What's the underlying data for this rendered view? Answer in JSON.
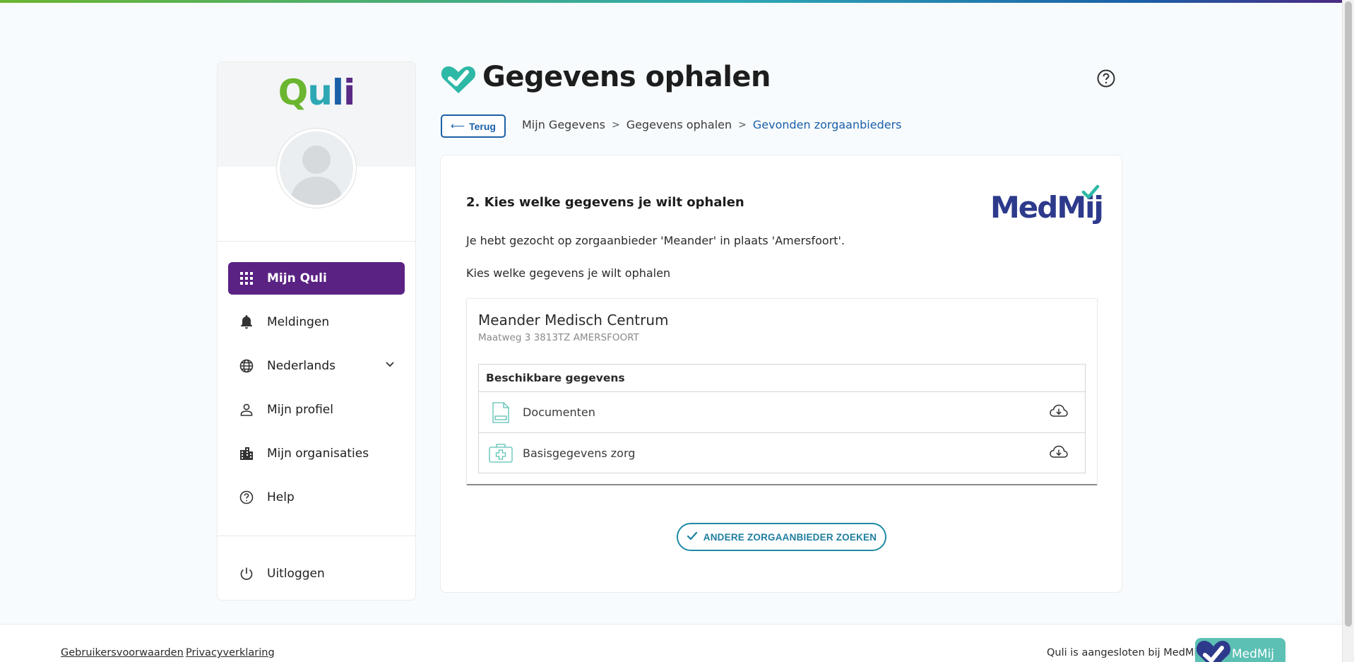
{
  "app": {
    "logo_text": "Quli"
  },
  "sidebar": {
    "items": [
      {
        "label": "Mijn Quli",
        "icon": "grid-icon",
        "active": true
      },
      {
        "label": "Meldingen",
        "icon": "bell-icon"
      },
      {
        "label": "Nederlands",
        "icon": "globe-icon"
      },
      {
        "label": "Mijn profiel",
        "icon": "person-icon"
      },
      {
        "label": "Mijn organisaties",
        "icon": "buildings-icon"
      },
      {
        "label": "Help",
        "icon": "help-circle-icon"
      }
    ],
    "logout_label": "Uitloggen"
  },
  "header": {
    "title": "Gegevens ophalen",
    "back_label": "Terug",
    "breadcrumb": [
      "Mijn Gegevens",
      "Gegevens ophalen",
      "Gevonden zorgaanbieders"
    ]
  },
  "card": {
    "step_title": "2. Kies welke gegevens je wilt ophalen",
    "medmij_logo_text": "MedMij",
    "search_info": "Je hebt gezocht op zorgaanbieder 'Meander' in plaats 'Amersfoort'.",
    "instruction": "Kies welke gegevens je wilt ophalen",
    "provider": {
      "name": "Meander Medisch Centrum",
      "address": "Maatweg 3 3813TZ AMERSFOORT",
      "available_header": "Beschikbare gegevens",
      "items": [
        {
          "label": "Documenten",
          "icon": "document-icon"
        },
        {
          "label": "Basisgegevens zorg",
          "icon": "medical-kit-icon"
        }
      ]
    },
    "other_button": "ANDERE ZORGAANBIEDER ZOEKEN"
  },
  "footer": {
    "terms": "Gebruikersvoorwaarden",
    "privacy": "Privacyverklaring",
    "connected_text": "Quli is aangesloten bij MedMij",
    "badge_text": "MedMij"
  },
  "colors": {
    "brand_purple": "#5a2283",
    "link_blue": "#1b5fa8",
    "teal": "#2eb8a6",
    "button_teal": "#1f8aa6"
  }
}
